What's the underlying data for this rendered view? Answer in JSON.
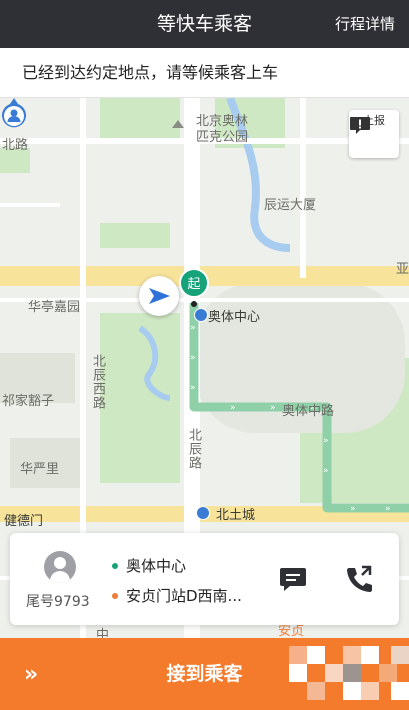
{
  "header": {
    "title": "等快车乘客",
    "details_link": "行程详情"
  },
  "notice": {
    "text": "已经到达约定地点，请等候乘客上车"
  },
  "map": {
    "report_button": {
      "icon": "alert-icon",
      "label": "上报"
    },
    "start_marker_label": "起",
    "labels": {
      "north_road": "北路",
      "park": "北京奥林匹克公园",
      "chenyun": "辰运大厦",
      "ya": "亚",
      "huating": "华亭嘉园",
      "aoti_center_stop": "奥体中心",
      "beichen_west_road": "北辰西路",
      "qijiahuozi": "祁家豁子",
      "aoti_road": "奥体中路",
      "huayanli": "华严里",
      "beichen_road": "北辰路",
      "jiandemen": "健德门",
      "beitucheng": "北土城",
      "zhong": "中",
      "anzhen": "安贞"
    },
    "colors": {
      "route": "#8fd0a8",
      "road": "#f7e39a",
      "green": "#cfe8c4",
      "water": "#a7ccef"
    }
  },
  "trip": {
    "tail_number": "尾号9793",
    "start": "奥体中心",
    "end": "安贞门站D西南...",
    "message_icon": "message-icon",
    "call_icon": "phone-icon"
  },
  "action": {
    "label": "接到乘客",
    "swipe_icon": "double-chevron-right-icon"
  }
}
